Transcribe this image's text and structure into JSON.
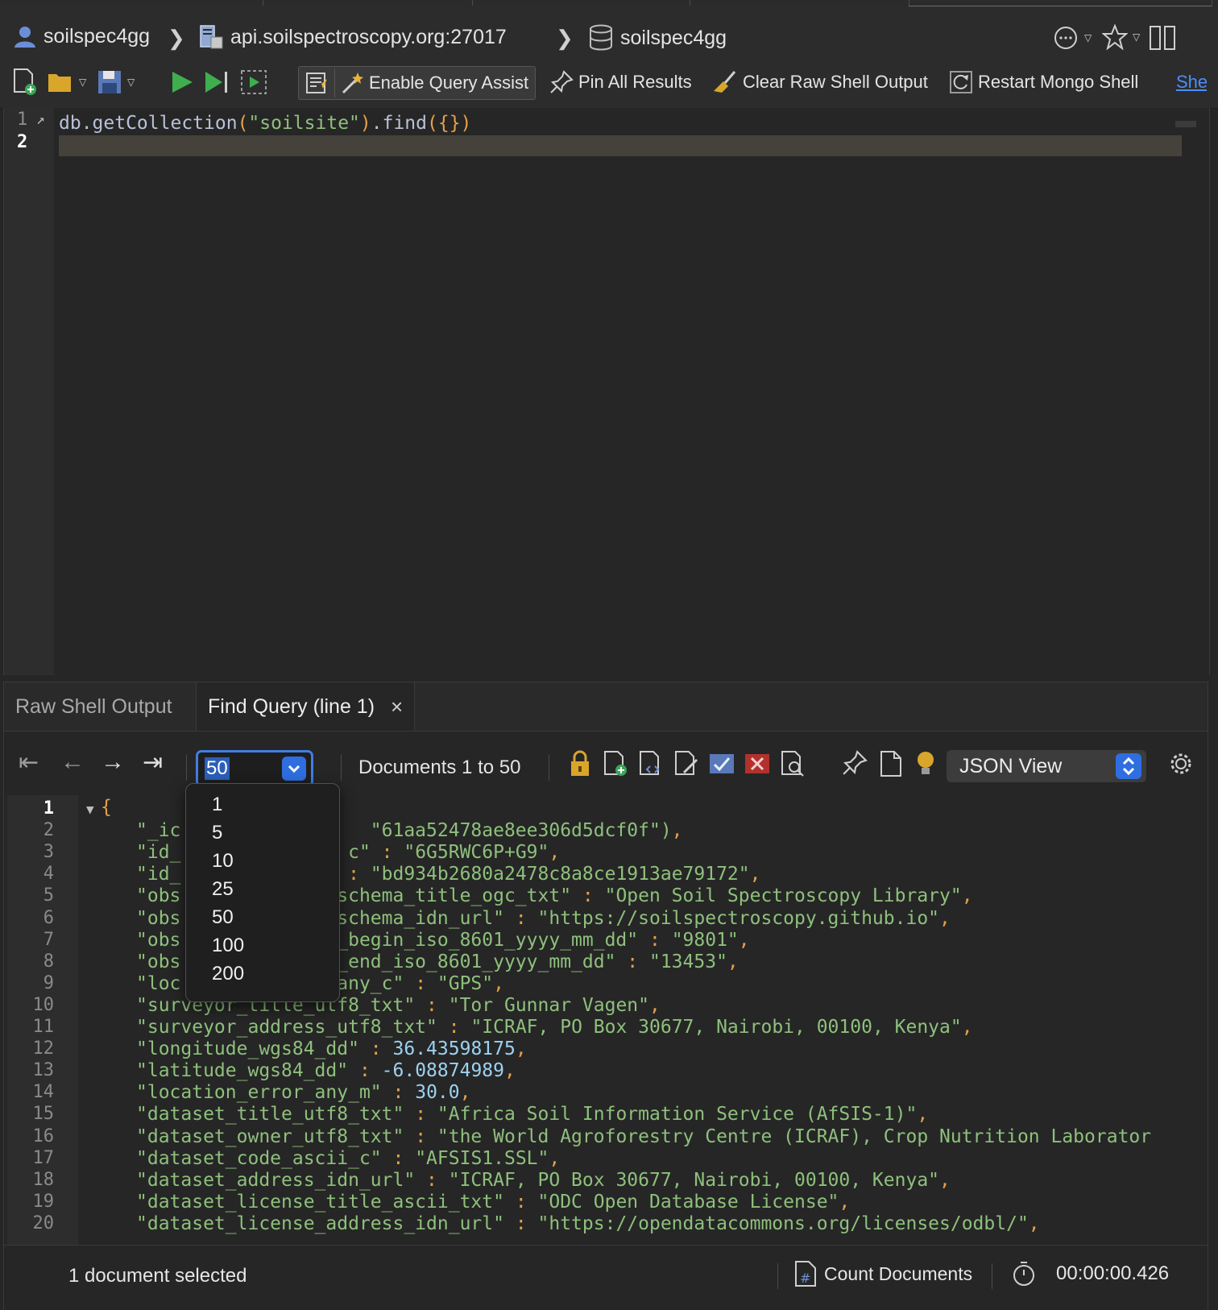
{
  "breadcrumb": {
    "user": "soilspec4gg",
    "server": "api.soilspectroscopy.org:27017",
    "database": "soilspec4gg"
  },
  "toolbar": {
    "enable_query_assist": "Enable Query Assist",
    "pin_all_results": "Pin All Results",
    "clear_raw_shell_output": "Clear Raw Shell Output",
    "restart_mongo_shell": "Restart Mongo Shell",
    "shell_link": "She"
  },
  "editor": {
    "lines": [
      "1",
      "2"
    ],
    "code": {
      "obj": "db.getCollection",
      "p1": "(",
      "str": "\"soilsite\"",
      "p2": ")",
      "method": ".find",
      "p3": "({})"
    }
  },
  "results": {
    "tabs": {
      "raw": "Raw Shell Output",
      "find": "Find Query (line 1)",
      "close": "×"
    },
    "limit": "50",
    "limit_options": [
      "1",
      "5",
      "10",
      "25",
      "50",
      "100",
      "200"
    ],
    "range": "Documents 1 to 50",
    "view": "JSON View",
    "status": "1 document selected",
    "count_documents": "Count Documents",
    "elapsed": "00:00:00.426"
  },
  "json": {
    "line_numbers": [
      "1",
      "2",
      "3",
      "4",
      "5",
      "6",
      "7",
      "8",
      "9",
      "10",
      "11",
      "12",
      "13",
      "14",
      "15",
      "16",
      "17",
      "18",
      "19",
      "20"
    ],
    "brace": "{",
    "lines": [
      "\"_ic                 \"61aa52478ae8ee306d5dcf0f\"),",
      "\"id_               c\" : \"6G5RWC6P+G9\",",
      "\"id_               : \"bd934b2680a2478c8a8ce1913ae79172\",",
      "\"obs              schema_title_ogc_txt\" : \"Open Soil Spectroscopy Library\",",
      "\"obs              schema_idn_url\" : \"https://soilspectroscopy.github.io\",",
      "\"obs              _begin_iso_8601_yyyy_mm_dd\" : \"9801\",",
      "\"obs              _end_iso_8601_yyyy_mm_dd\" : \"13453\",",
      "\"loc              any_c\" : \"GPS\",",
      "\"surveyor_title_utf8_txt\" : \"Tor Gunnar Vagen\",",
      "\"surveyor_address_utf8_txt\" : \"ICRAF, PO Box 30677, Nairobi, 00100, Kenya\",",
      "\"longitude_wgs84_dd\" : 36.43598175,",
      "\"latitude_wgs84_dd\" : -6.08874989,",
      "\"location_error_any_m\" : 30.0,",
      "\"dataset_title_utf8_txt\" : \"Africa Soil Information Service (AfSIS-1)\",",
      "\"dataset_owner_utf8_txt\" : \"the World Agroforestry Centre (ICRAF), Crop Nutrition Laborator",
      "\"dataset_code_ascii_c\" : \"AFSIS1.SSL\",",
      "\"dataset_address_idn_url\" : \"ICRAF, PO Box 30677, Nairobi, 00100, Kenya\",",
      "\"dataset_license_title_ascii_txt\" : \"ODC Open Database License\",",
      "\"dataset_license_address_idn_url\" : \"https://opendatacommons.org/licenses/odbl/\","
    ]
  }
}
